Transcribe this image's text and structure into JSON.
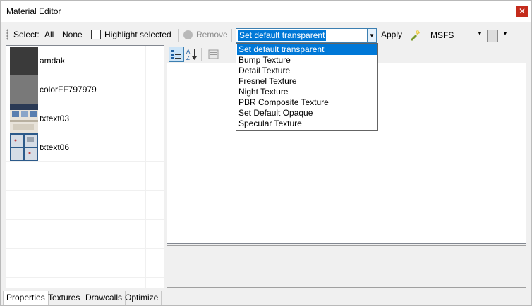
{
  "window": {
    "title": "Material Editor",
    "close_symbol": "✕"
  },
  "toolbar": {
    "select_label": "Select:",
    "all_label": "All",
    "none_label": "None",
    "highlight_label": "Highlight selected",
    "remove_label": "Remove",
    "texture_combo_value": "Set default transparent",
    "apply_label": "Apply",
    "sim_value": "MSFS"
  },
  "materials": [
    {
      "name": "amdak",
      "swatch": "#3a3a3a"
    },
    {
      "name": "colorFF797979",
      "swatch": "#797979"
    },
    {
      "name": "txtext03",
      "swatch": "#c9cfd6"
    },
    {
      "name": "txtext06",
      "swatch": "#d6dde6"
    }
  ],
  "dropdown_options": [
    "Set default transparent",
    "Bump Texture",
    "Detail Texture",
    "Fresnel Texture",
    "Night Texture",
    "PBR Composite Texture",
    "Set Default Opaque",
    "Specular Texture"
  ],
  "tabs": [
    "Properties",
    "Textures",
    "Drawcalls",
    "Optimize"
  ]
}
